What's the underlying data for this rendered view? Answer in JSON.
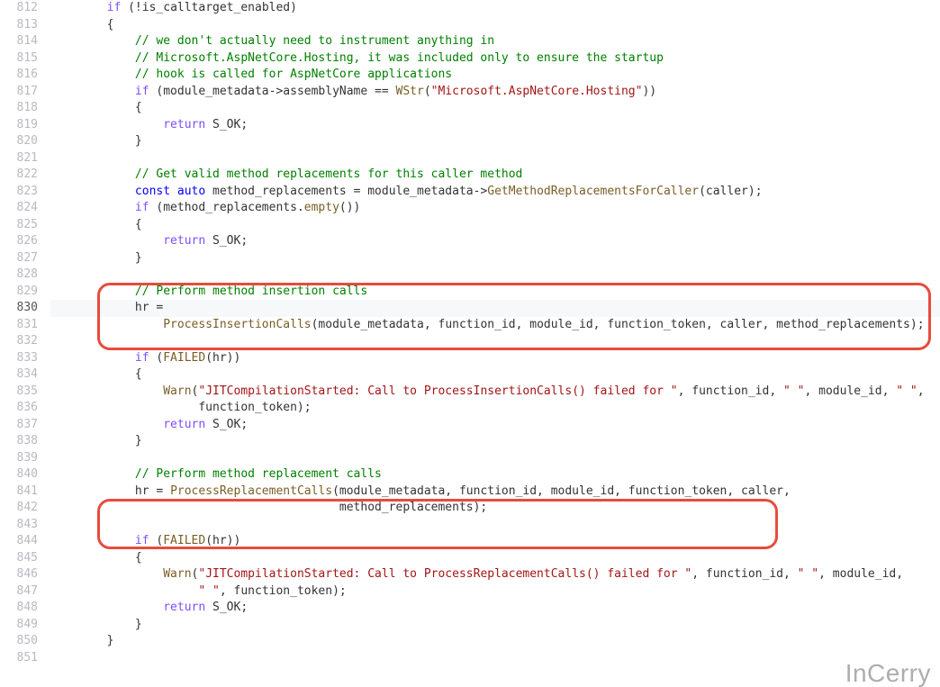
{
  "first_line": 812,
  "highlight_line": 830,
  "watermark": "InCerry",
  "code_lines": [
    {
      "ind": 4,
      "segs": [
        {
          "t": "if",
          "c": "ctl"
        },
        {
          "t": " (!is_calltarget_enabled)"
        }
      ]
    },
    {
      "ind": 4,
      "segs": [
        {
          "t": "{"
        }
      ]
    },
    {
      "ind": 8,
      "segs": [
        {
          "t": "// we don't actually need to instrument anything in",
          "c": "cm"
        }
      ]
    },
    {
      "ind": 8,
      "segs": [
        {
          "t": "// Microsoft.AspNetCore.Hosting, it was included only to ensure the startup",
          "c": "cm"
        }
      ]
    },
    {
      "ind": 8,
      "segs": [
        {
          "t": "// hook is called for AspNetCore applications",
          "c": "cm"
        }
      ]
    },
    {
      "ind": 8,
      "segs": [
        {
          "t": "if",
          "c": "ctl"
        },
        {
          "t": " (module_metadata->assemblyName == "
        },
        {
          "t": "WStr",
          "c": "fn"
        },
        {
          "t": "("
        },
        {
          "t": "\"Microsoft.AspNetCore.Hosting\"",
          "c": "str"
        },
        {
          "t": "))"
        }
      ]
    },
    {
      "ind": 8,
      "segs": [
        {
          "t": "{"
        }
      ]
    },
    {
      "ind": 12,
      "segs": [
        {
          "t": "return",
          "c": "ctl"
        },
        {
          "t": " S_OK;"
        }
      ]
    },
    {
      "ind": 8,
      "segs": [
        {
          "t": "}"
        }
      ]
    },
    {
      "ind": 0,
      "segs": []
    },
    {
      "ind": 8,
      "segs": [
        {
          "t": "// Get valid method replacements for this caller method",
          "c": "cm"
        }
      ]
    },
    {
      "ind": 8,
      "segs": [
        {
          "t": "const",
          "c": "kw"
        },
        {
          "t": " "
        },
        {
          "t": "auto",
          "c": "kw"
        },
        {
          "t": " method_replacements = module_metadata->"
        },
        {
          "t": "GetMethodReplacementsForCaller",
          "c": "fn"
        },
        {
          "t": "(caller);"
        }
      ]
    },
    {
      "ind": 8,
      "segs": [
        {
          "t": "if",
          "c": "ctl"
        },
        {
          "t": " (method_replacements."
        },
        {
          "t": "empty",
          "c": "fn"
        },
        {
          "t": "())"
        }
      ]
    },
    {
      "ind": 8,
      "segs": [
        {
          "t": "{"
        }
      ]
    },
    {
      "ind": 12,
      "segs": [
        {
          "t": "return",
          "c": "ctl"
        },
        {
          "t": " S_OK;"
        }
      ]
    },
    {
      "ind": 8,
      "segs": [
        {
          "t": "}"
        }
      ]
    },
    {
      "ind": 0,
      "segs": []
    },
    {
      "ind": 8,
      "segs": [
        {
          "t": "// Perform method insertion calls",
          "c": "cm"
        }
      ]
    },
    {
      "ind": 8,
      "segs": [
        {
          "t": "hr ="
        }
      ]
    },
    {
      "ind": 12,
      "segs": [
        {
          "t": "ProcessInsertionCalls",
          "c": "fn"
        },
        {
          "t": "(module_metadata, function_id, module_id, function_token, caller, method_replacements);"
        }
      ]
    },
    {
      "ind": 0,
      "segs": []
    },
    {
      "ind": 8,
      "segs": [
        {
          "t": "if",
          "c": "ctl"
        },
        {
          "t": " ("
        },
        {
          "t": "FAILED",
          "c": "fn"
        },
        {
          "t": "(hr))"
        }
      ]
    },
    {
      "ind": 8,
      "segs": [
        {
          "t": "{"
        }
      ]
    },
    {
      "ind": 12,
      "segs": [
        {
          "t": "Warn",
          "c": "fn"
        },
        {
          "t": "("
        },
        {
          "t": "\"JITCompilationStarted: Call to ProcessInsertionCalls() failed for \"",
          "c": "str"
        },
        {
          "t": ", function_id, "
        },
        {
          "t": "\" \"",
          "c": "str"
        },
        {
          "t": ", module_id, "
        },
        {
          "t": "\" \"",
          "c": "str"
        },
        {
          "t": ","
        }
      ]
    },
    {
      "ind": 17,
      "segs": [
        {
          "t": "function_token);"
        }
      ]
    },
    {
      "ind": 12,
      "segs": [
        {
          "t": "return",
          "c": "ctl"
        },
        {
          "t": " S_OK;"
        }
      ]
    },
    {
      "ind": 8,
      "segs": [
        {
          "t": "}"
        }
      ]
    },
    {
      "ind": 0,
      "segs": []
    },
    {
      "ind": 8,
      "segs": [
        {
          "t": "// Perform method replacement calls",
          "c": "cm"
        }
      ]
    },
    {
      "ind": 8,
      "segs": [
        {
          "t": "hr = "
        },
        {
          "t": "ProcessReplacementCalls",
          "c": "fn"
        },
        {
          "t": "(module_metadata, function_id, module_id, function_token, caller,"
        }
      ]
    },
    {
      "ind": 37,
      "segs": [
        {
          "t": "method_replacements);"
        }
      ]
    },
    {
      "ind": 0,
      "segs": []
    },
    {
      "ind": 8,
      "segs": [
        {
          "t": "if",
          "c": "ctl"
        },
        {
          "t": " ("
        },
        {
          "t": "FAILED",
          "c": "fn"
        },
        {
          "t": "(hr))"
        }
      ]
    },
    {
      "ind": 8,
      "segs": [
        {
          "t": "{"
        }
      ]
    },
    {
      "ind": 12,
      "segs": [
        {
          "t": "Warn",
          "c": "fn"
        },
        {
          "t": "("
        },
        {
          "t": "\"JITCompilationStarted: Call to ProcessReplacementCalls() failed for \"",
          "c": "str"
        },
        {
          "t": ", function_id, "
        },
        {
          "t": "\" \"",
          "c": "str"
        },
        {
          "t": ", module_id,"
        }
      ]
    },
    {
      "ind": 17,
      "segs": [
        {
          "t": "\" \"",
          "c": "str"
        },
        {
          "t": ", function_token);"
        }
      ]
    },
    {
      "ind": 12,
      "segs": [
        {
          "t": "return",
          "c": "ctl"
        },
        {
          "t": " S_OK;"
        }
      ]
    },
    {
      "ind": 8,
      "segs": [
        {
          "t": "}"
        }
      ]
    },
    {
      "ind": 4,
      "segs": [
        {
          "t": "}"
        }
      ]
    },
    {
      "ind": 0,
      "segs": []
    }
  ]
}
